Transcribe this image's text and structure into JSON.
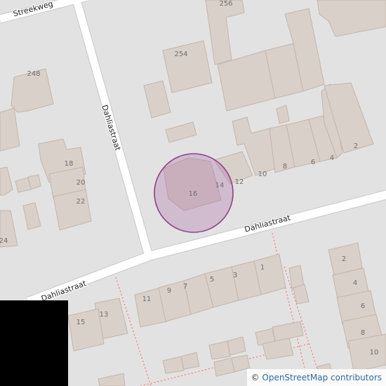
{
  "map": {
    "streets": {
      "streekweg": "Streekweg",
      "dahlia_vertical": "Dahliastraat",
      "dahlia_main": "Dahliastraat",
      "dahlia_lower": "Dahliastraat"
    },
    "house_numbers": {
      "n256": "256",
      "n254": "254",
      "n248": "248",
      "n18": "18",
      "n20": "20",
      "n22": "22",
      "n24": "24",
      "n16": "16",
      "n14": "14",
      "n12": "12",
      "n10": "10",
      "n8": "8",
      "n6": "6",
      "n4": "4",
      "n2": "2",
      "s11": "11",
      "s9": "9",
      "s7": "7",
      "s5": "5",
      "s3": "3",
      "s1": "1",
      "s13": "13",
      "s15": "15",
      "e2": "2",
      "e4": "4",
      "e6": "6",
      "e8": "8",
      "e10": "10"
    },
    "colors": {
      "background": "#e2e2e2",
      "building": "#d9d0c9",
      "road": "#ffffff",
      "footpath": "#fa8072",
      "marker": "#a35a9a"
    }
  },
  "attribution": {
    "copyright_symbol": "©",
    "link_text": "OpenStreetMap contributors"
  }
}
